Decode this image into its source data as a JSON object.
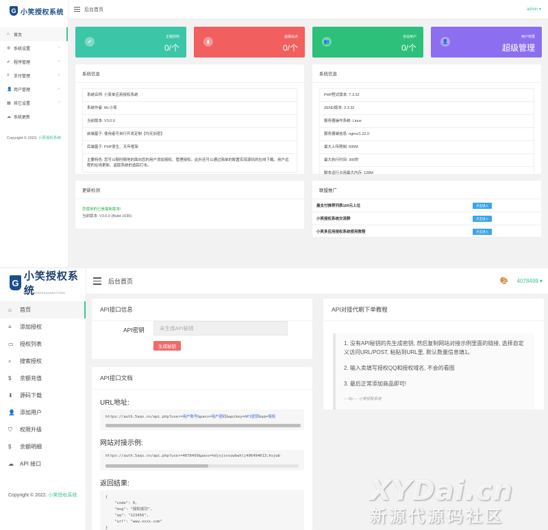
{
  "top": {
    "logo_text": "小笑授权系统",
    "logo_glyph": "G",
    "header": {
      "crumb": "后台首页",
      "user": "admin ▾"
    },
    "nav": [
      {
        "icon": "home-icon",
        "glyph": "⌂",
        "label": "首页",
        "active": true,
        "arrow": ""
      },
      {
        "icon": "gear-icon",
        "glyph": "⚙",
        "label": "系统设置",
        "arrow": "›"
      },
      {
        "icon": "check-circle-icon",
        "glyph": "✔",
        "label": "程序管理",
        "arrow": "›"
      },
      {
        "icon": "list-icon",
        "glyph": "≡",
        "label": "支付管理",
        "arrow": "›"
      },
      {
        "icon": "user-icon",
        "glyph": "👤",
        "label": "用户管理",
        "arrow": "›"
      },
      {
        "icon": "grid-icon",
        "glyph": "▦",
        "label": "其它设置",
        "arrow": "›"
      },
      {
        "icon": "cloud-icon",
        "glyph": "☁",
        "label": "系统更新",
        "arrow": ""
      }
    ],
    "copyright_prefix": "Copyright © 2023.",
    "copyright_link": "小笑授权系统",
    "stats": [
      {
        "label": "正版授权",
        "value": "0/个",
        "glyph": "✔",
        "icon": "check-icon",
        "color": "#3cc6a8"
      },
      {
        "label": "盗版站点",
        "value": "0/个",
        "glyph": "▮",
        "icon": "trash-icon",
        "color": "#f25f5f"
      },
      {
        "label": "全站用户",
        "value": "0/个",
        "glyph": "👥",
        "icon": "users-icon",
        "color": "#2cc07a"
      },
      {
        "label": "用户权限",
        "value": "超级管理",
        "glyph": "👤",
        "icon": "person-icon",
        "color": "#8c6ff0"
      }
    ],
    "sysinfo_left": {
      "title": "系统信息",
      "rows": [
        "系统名称: 小笑单应用授权系统",
        "系统作者: Mr.小笑",
        "当前版本: V3.0.0",
        "前端基于: 使用者可自行开发定制【均无加密】",
        "后端基于: PHP原生、无年框架",
        "主要特色: 您可以随时随地的面向您的用户添加授权、管理授权。此外还可以通过简单的配置实现源码的在线下载。用户远程的在线更新、盗版系统的追踪打击。"
      ]
    },
    "sysinfo_right": {
      "title": "系统信息",
      "rows": [
        "PHP程式版本: 7.3.32",
        "ZEND版本: 3.3.32",
        "服务器操作系统: Linux",
        "服务器端信息: nginx/1.22.0",
        "最大上传限制: 500M",
        "最大执行时间: 300秒",
        "脚本运行占用最大内存: 128M"
      ]
    },
    "update": {
      "title": "更新检测",
      "status": "您使用的已是最新版本!",
      "version": "当前版本: V3.0.0 (Build 1030)"
    },
    "league": {
      "title": "联盟推广",
      "button_label": "点击进入",
      "rows": [
        "最支付推荐列表100元上位",
        "小笑授权系统交流群",
        "小笑多应用授权系统使用教程"
      ]
    }
  },
  "bottom": {
    "logo_text": "小笑授权系统",
    "logo_glyph": "G",
    "logo_sub": "XIAOXIAOSHOUQUANXITONG",
    "header": {
      "crumb": "后台首页",
      "user": "4078499 ▾"
    },
    "nav": [
      {
        "icon": "home-icon",
        "glyph": "⌂",
        "label": "首页",
        "active": true
      },
      {
        "icon": "list-icon",
        "glyph": "≡",
        "label": "添加授权"
      },
      {
        "icon": "monitor-icon",
        "glyph": "▭",
        "label": "授权列表"
      },
      {
        "icon": "search-icon",
        "glyph": "⌕",
        "label": "搜索授权"
      },
      {
        "icon": "dollar-icon",
        "glyph": "$",
        "label": "余额充值"
      },
      {
        "icon": "download-icon",
        "glyph": "⬇",
        "label": "源码下载"
      },
      {
        "icon": "add-user-icon",
        "glyph": "👤",
        "label": "添加用户"
      },
      {
        "icon": "shield-icon",
        "glyph": "⛉",
        "label": "权限升级"
      },
      {
        "icon": "dollar-icon",
        "glyph": "$",
        "label": "余额明细"
      },
      {
        "icon": "cloud-icon",
        "glyph": "☁",
        "label": "API 接口"
      }
    ],
    "copyright_prefix": "Copyright © 2022.",
    "copyright_link": "小笑授权系统",
    "api_info": {
      "title": "API接口信息",
      "label": "API密钥",
      "placeholder": "未生成API秘钥",
      "button": "生成秘钥"
    },
    "api_doc": {
      "title": "API接口文档",
      "url_heading": "URL地址:",
      "url_prefix": "https://auth.5aqs.cn/api.php?user=",
      "url_p1": "用户账号",
      "url_mid1": "&pass=",
      "url_p2": "用户密码",
      "url_mid2": "&apikey=",
      "url_p3": "API密钥",
      "url_mid3": "&qq=",
      "url_p4": "授权",
      "example_heading": "网站对接示例:",
      "example_code": "https://auth.5aqs.cn/api.php?user=4078499&pass=hdjsjsvsuwbwhlj406494013;hsjwb",
      "result_heading": "返回结果:",
      "result_code": "{\n    \"code\": 0,\n    \"msg\": \"授权成功\",\n    \"qq\": \"123456\",\n    \"url\": \"www.xxxx.com\"\n}"
    },
    "tutorial": {
      "title": "API对接代刷下单教程",
      "steps": [
        "1. 没有API秘钥的先生成密钥, 然后复制网站对接示例里面的链接, 选择自定义访问URL/POST, 粘贴到URL里, 默认数量信息填1。",
        "2. 输入卖填写授权QQ和授权域名, 不会的看图",
        "3. 最后正常添加商品即可!"
      ],
      "signature": "— By -.- 小笑授权系统"
    },
    "watermark_en": "XYDai.cn",
    "watermark_cn": "新源代源码社区"
  }
}
